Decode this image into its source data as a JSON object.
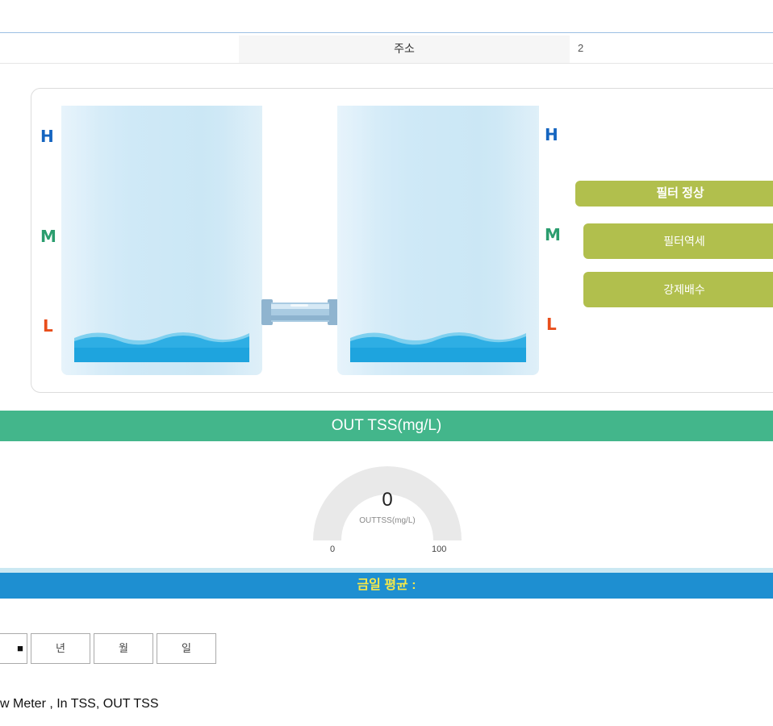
{
  "address": {
    "label": "주소",
    "value": "2"
  },
  "levels": {
    "high": "H",
    "mid": "M",
    "low": "L"
  },
  "filter_status": "필터 정상",
  "actions": {
    "backwash": "필터역세",
    "forced_drain": "강제배수"
  },
  "tss": {
    "title": "OUT TSS(mg/L)",
    "value": "0",
    "label": "OUTTSS(mg/L)",
    "min": "0",
    "max": "100",
    "level": 0
  },
  "daily_avg": {
    "title": "금일 평균 :"
  },
  "period_tabs": [
    "년",
    "월",
    "일"
  ],
  "period_tab_first_partial": "■",
  "legend": "w Meter , In TSS, OUT TSS",
  "colors": {
    "green": "#43b68b",
    "blue": "#1e8fd1",
    "olive": "#b1bf4d",
    "yellow": "#f5e84a"
  }
}
